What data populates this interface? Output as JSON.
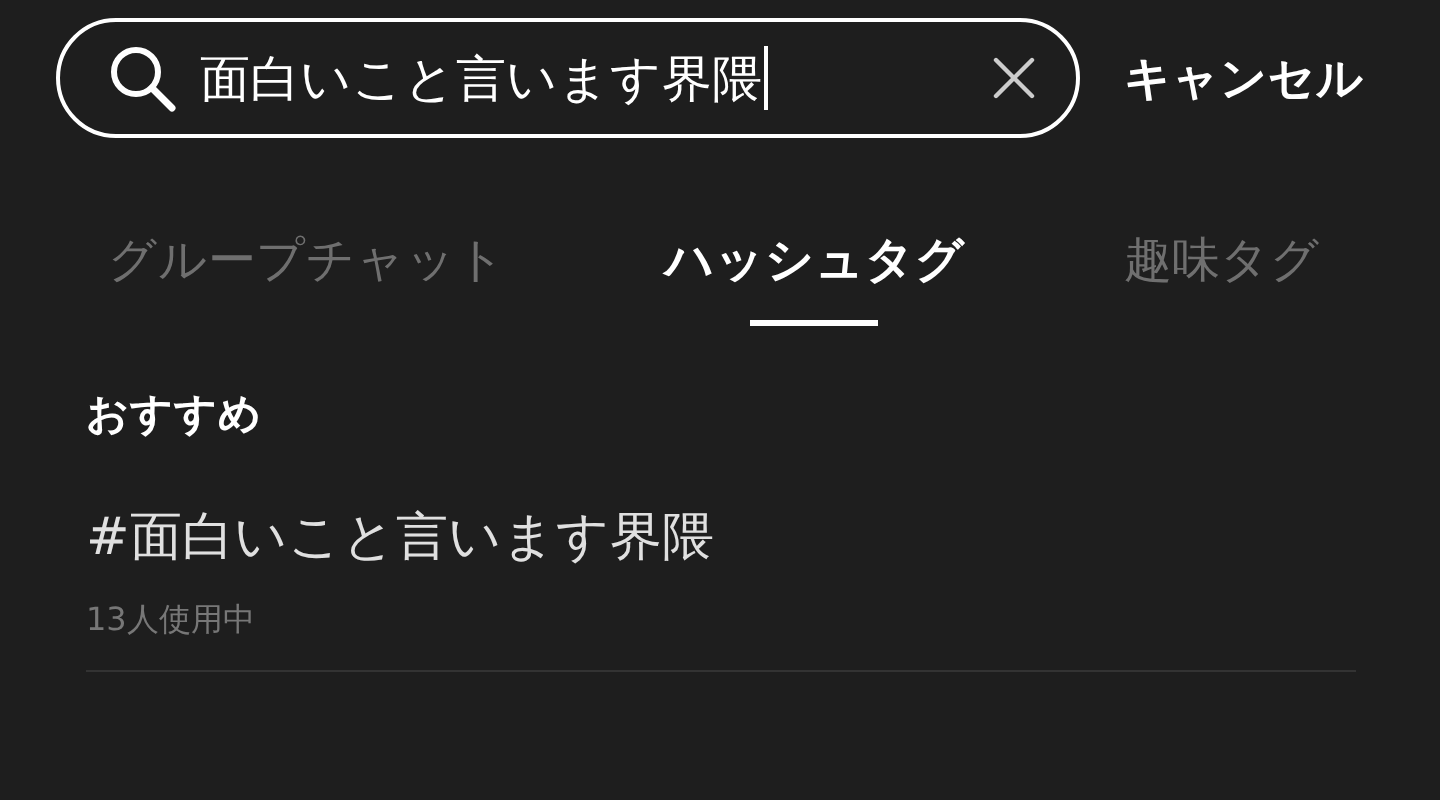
{
  "search": {
    "value": "面白いこと言います界隈",
    "focused": true
  },
  "cancel": "キャンセル",
  "tabs": [
    {
      "label": "グループチャット",
      "selected": false
    },
    {
      "label": "ハッシュタグ",
      "selected": true
    },
    {
      "label": "趣味タグ",
      "selected": false
    }
  ],
  "section_title": "おすすめ",
  "results": [
    {
      "tag": "#面白いこと言います界隈",
      "usage": "13人使用中"
    }
  ]
}
